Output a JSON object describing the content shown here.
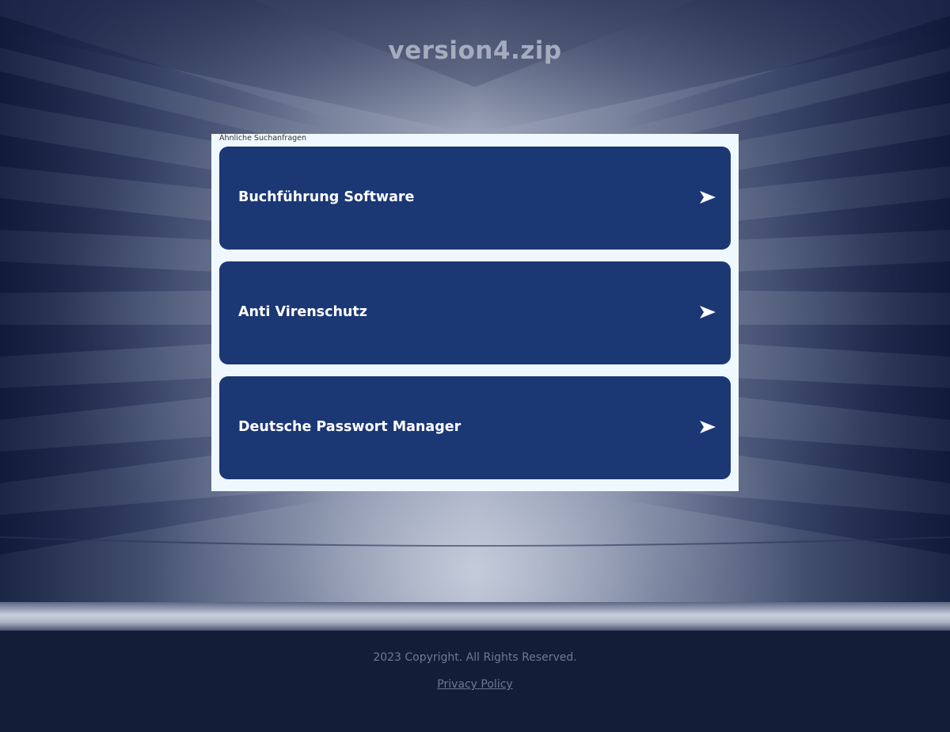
{
  "header": {
    "title": "version4.zip"
  },
  "panel": {
    "label": "Ähnliche Suchanfragen",
    "results": [
      {
        "label": "Buchführung Software",
        "icon": "arrow-right-icon"
      },
      {
        "label": "Anti Virenschutz",
        "icon": "arrow-right-icon"
      },
      {
        "label": "Deutsche Passwort Manager",
        "icon": "arrow-right-icon"
      }
    ]
  },
  "footer": {
    "copyright": "2023 Copyright. All Rights Reserved.",
    "privacy": "Privacy Policy"
  },
  "colors": {
    "result_bg": "#1b3774",
    "panel_bg": "#f0f8ff",
    "footer_bg": "#121d38",
    "title": "#a5acbf"
  }
}
